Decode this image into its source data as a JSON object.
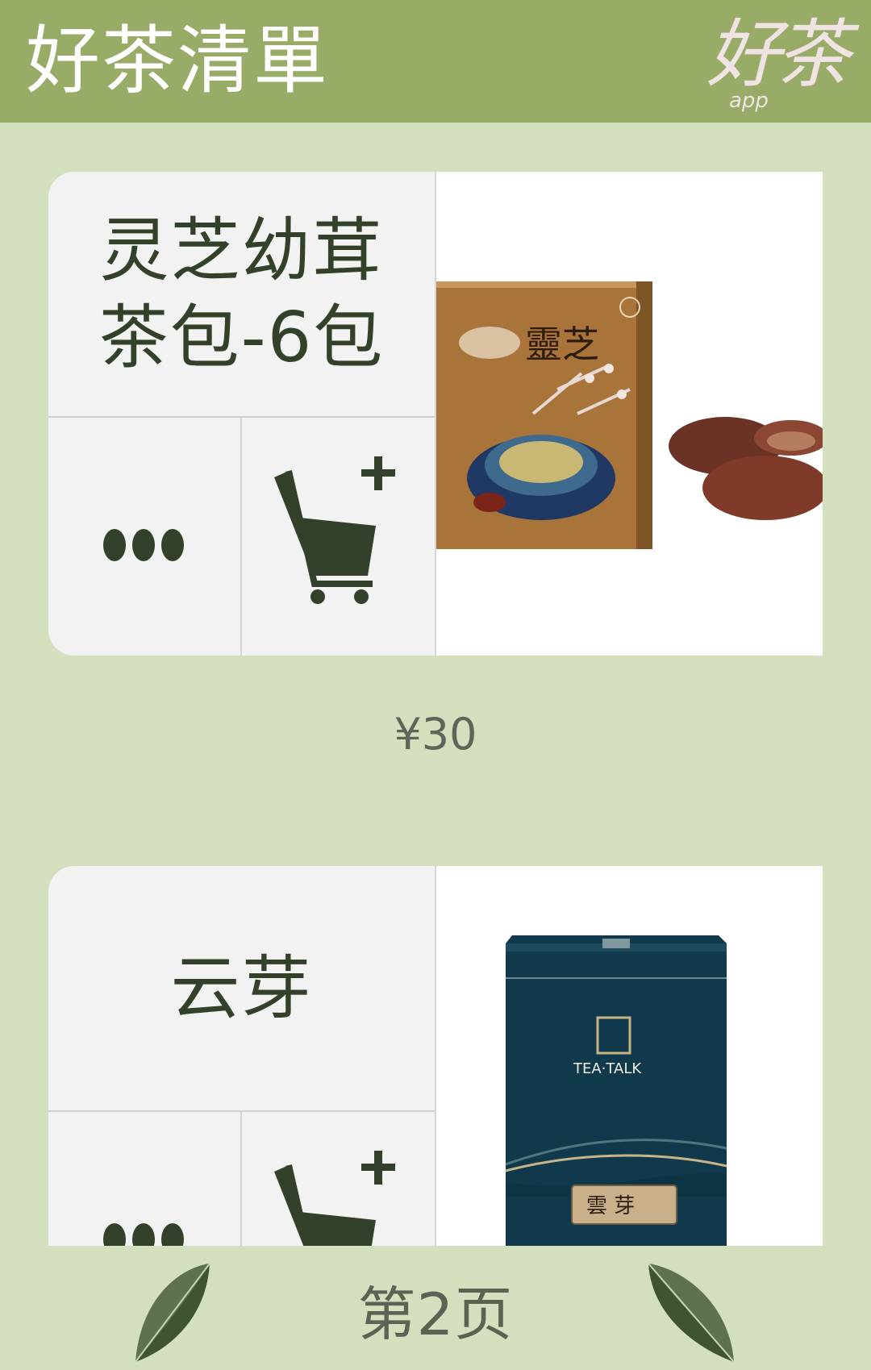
{
  "header": {
    "title": "好茶清單",
    "logo_text": "好茶",
    "logo_sub": "app"
  },
  "products": [
    {
      "name": "灵芝幼茸茶包-6包",
      "price": "¥30",
      "image_icon": "reishi-tea-box-image",
      "box_brand_text": "靈芝"
    },
    {
      "name": "云芽",
      "image_icon": "yunya-tea-box-image",
      "box_brand_text": "TEA·TALK",
      "box_label_text": "雲 芽"
    }
  ],
  "footer": {
    "page_label": "第2页",
    "prev_icon": "leaf-left-icon",
    "next_icon": "leaf-right-icon"
  },
  "colors": {
    "header_bg": "#98ab67",
    "page_bg": "#d4dfbe",
    "card_bg": "#f2f2f2",
    "icon_dark": "#34412a"
  }
}
